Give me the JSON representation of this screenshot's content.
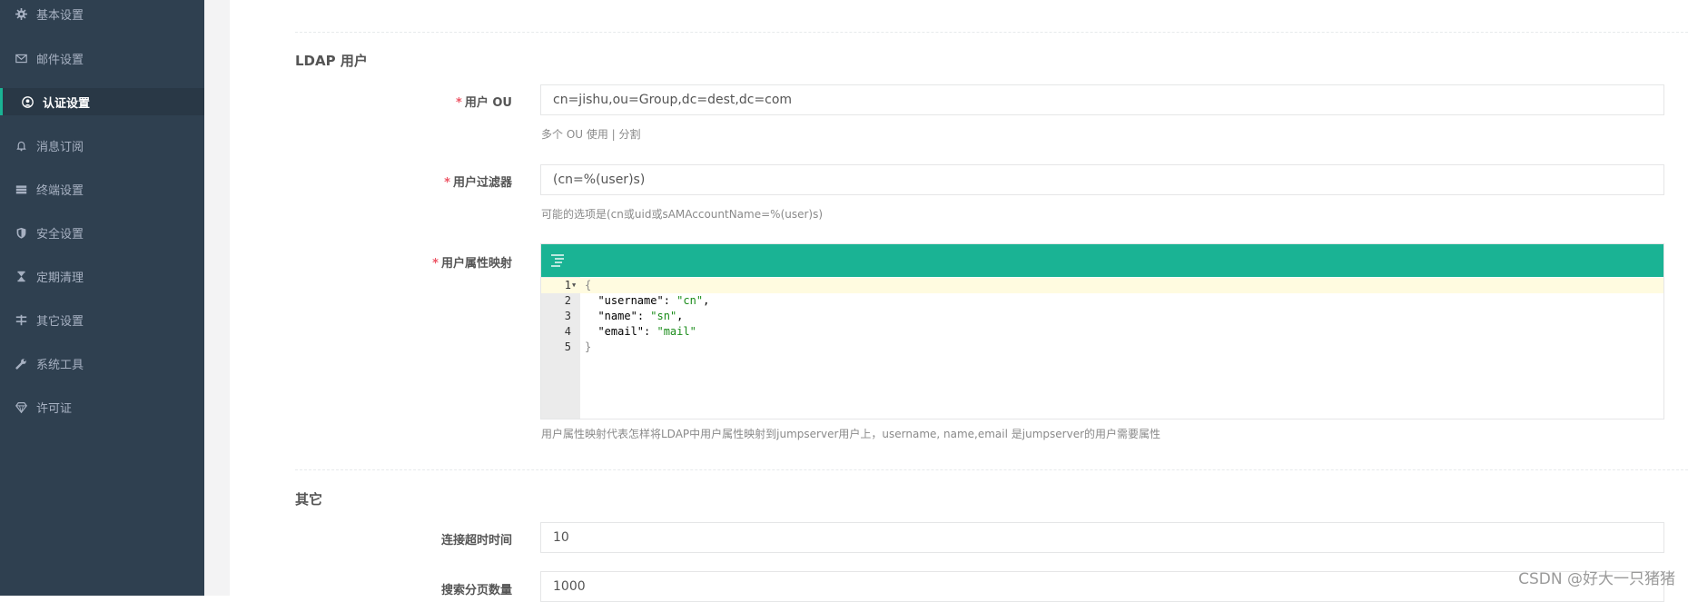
{
  "sidebar": {
    "items": [
      {
        "label": "基本设置",
        "icon": "gear-icon"
      },
      {
        "label": "邮件设置",
        "icon": "envelope-icon"
      },
      {
        "label": "认证设置",
        "icon": "user-circle-icon",
        "active": true
      },
      {
        "label": "消息订阅",
        "icon": "bell-icon"
      },
      {
        "label": "终端设置",
        "icon": "server-icon"
      },
      {
        "label": "安全设置",
        "icon": "shield-icon"
      },
      {
        "label": "定期清理",
        "icon": "hourglass-icon"
      },
      {
        "label": "其它设置",
        "icon": "sliders-icon"
      },
      {
        "label": "系统工具",
        "icon": "wrench-icon"
      },
      {
        "label": "许可证",
        "icon": "diamond-icon"
      }
    ]
  },
  "ldap_user": {
    "title": "LDAP 用户",
    "user_ou": {
      "label": "用户 OU",
      "value": "cn=jishu,ou=Group,dc=dest,dc=com",
      "help": "多个 OU 使用 | 分割"
    },
    "user_filter": {
      "label": "用户过滤器",
      "value": "(cn=%(user)s)",
      "help": "可能的选项是(cn或uid或sAMAccountName=%(user)s)"
    },
    "attr_map": {
      "label": "用户属性映射",
      "help": "用户属性映射代表怎样将LDAP中用户属性映射到jumpserver用户上，username, name,email 是jumpserver的用户需要属性",
      "lines": [
        {
          "n": "1",
          "open": "{"
        },
        {
          "n": "2",
          "key": "\"username\"",
          "val": "\"cn\"",
          "comma": ","
        },
        {
          "n": "3",
          "key": "\"name\"",
          "val": "\"sn\"",
          "comma": ","
        },
        {
          "n": "4",
          "key": "\"email\"",
          "val": "\"mail\"",
          "comma": ""
        },
        {
          "n": "5",
          "close": "}"
        }
      ]
    }
  },
  "other": {
    "title": "其它",
    "timeout": {
      "label": "连接超时时间",
      "value": "10"
    },
    "page_size": {
      "label": "搜索分页数量",
      "value": "1000"
    }
  },
  "required_mark": "*",
  "watermark": "CSDN @好大一只猪猪",
  "colors": {
    "sidebar_bg": "#2f4050",
    "accent": "#1ab394",
    "required": "#ed5565"
  }
}
